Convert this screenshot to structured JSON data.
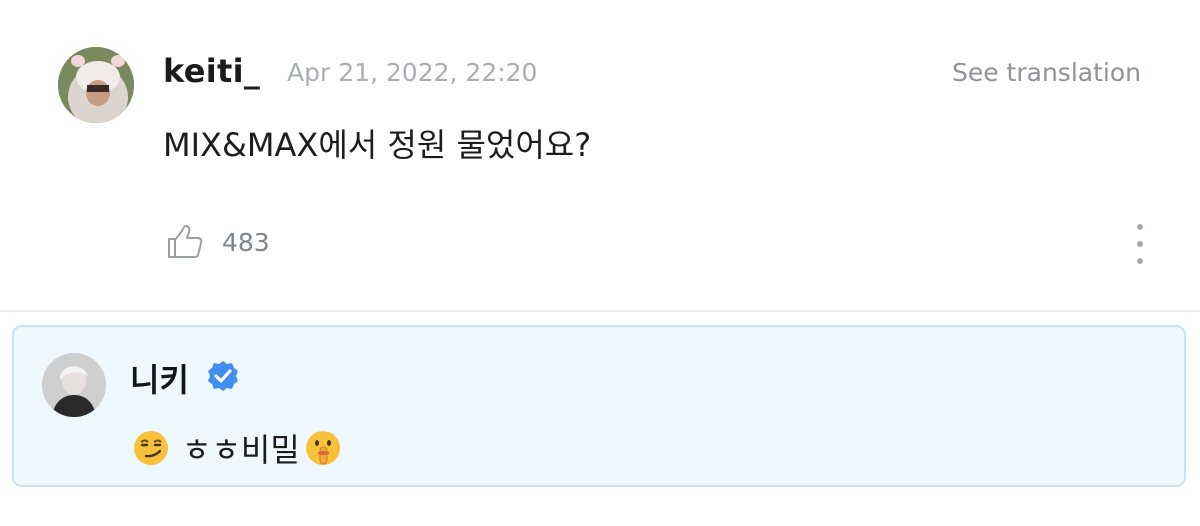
{
  "comment": {
    "username": "keiti_",
    "timestamp": "Apr 21, 2022, 22:20",
    "translate_label": "See translation",
    "text": "MIX&MAX에서 정원 물었어요?",
    "like_count": "483"
  },
  "reply": {
    "artist_name": "니키",
    "text": "ㅎㅎ비밀",
    "verified": true
  },
  "colors": {
    "reply_background": "#eef8fe",
    "reply_border": "#c6e3f3",
    "verified_badge": "#3f8ef0"
  },
  "icons": {
    "like": "thumbs-up-icon",
    "more": "vertical-ellipsis-icon",
    "verified": "verified-badge-icon",
    "emoji_left": "smirking-face-emoji",
    "emoji_right": "shushing-face-emoji"
  }
}
